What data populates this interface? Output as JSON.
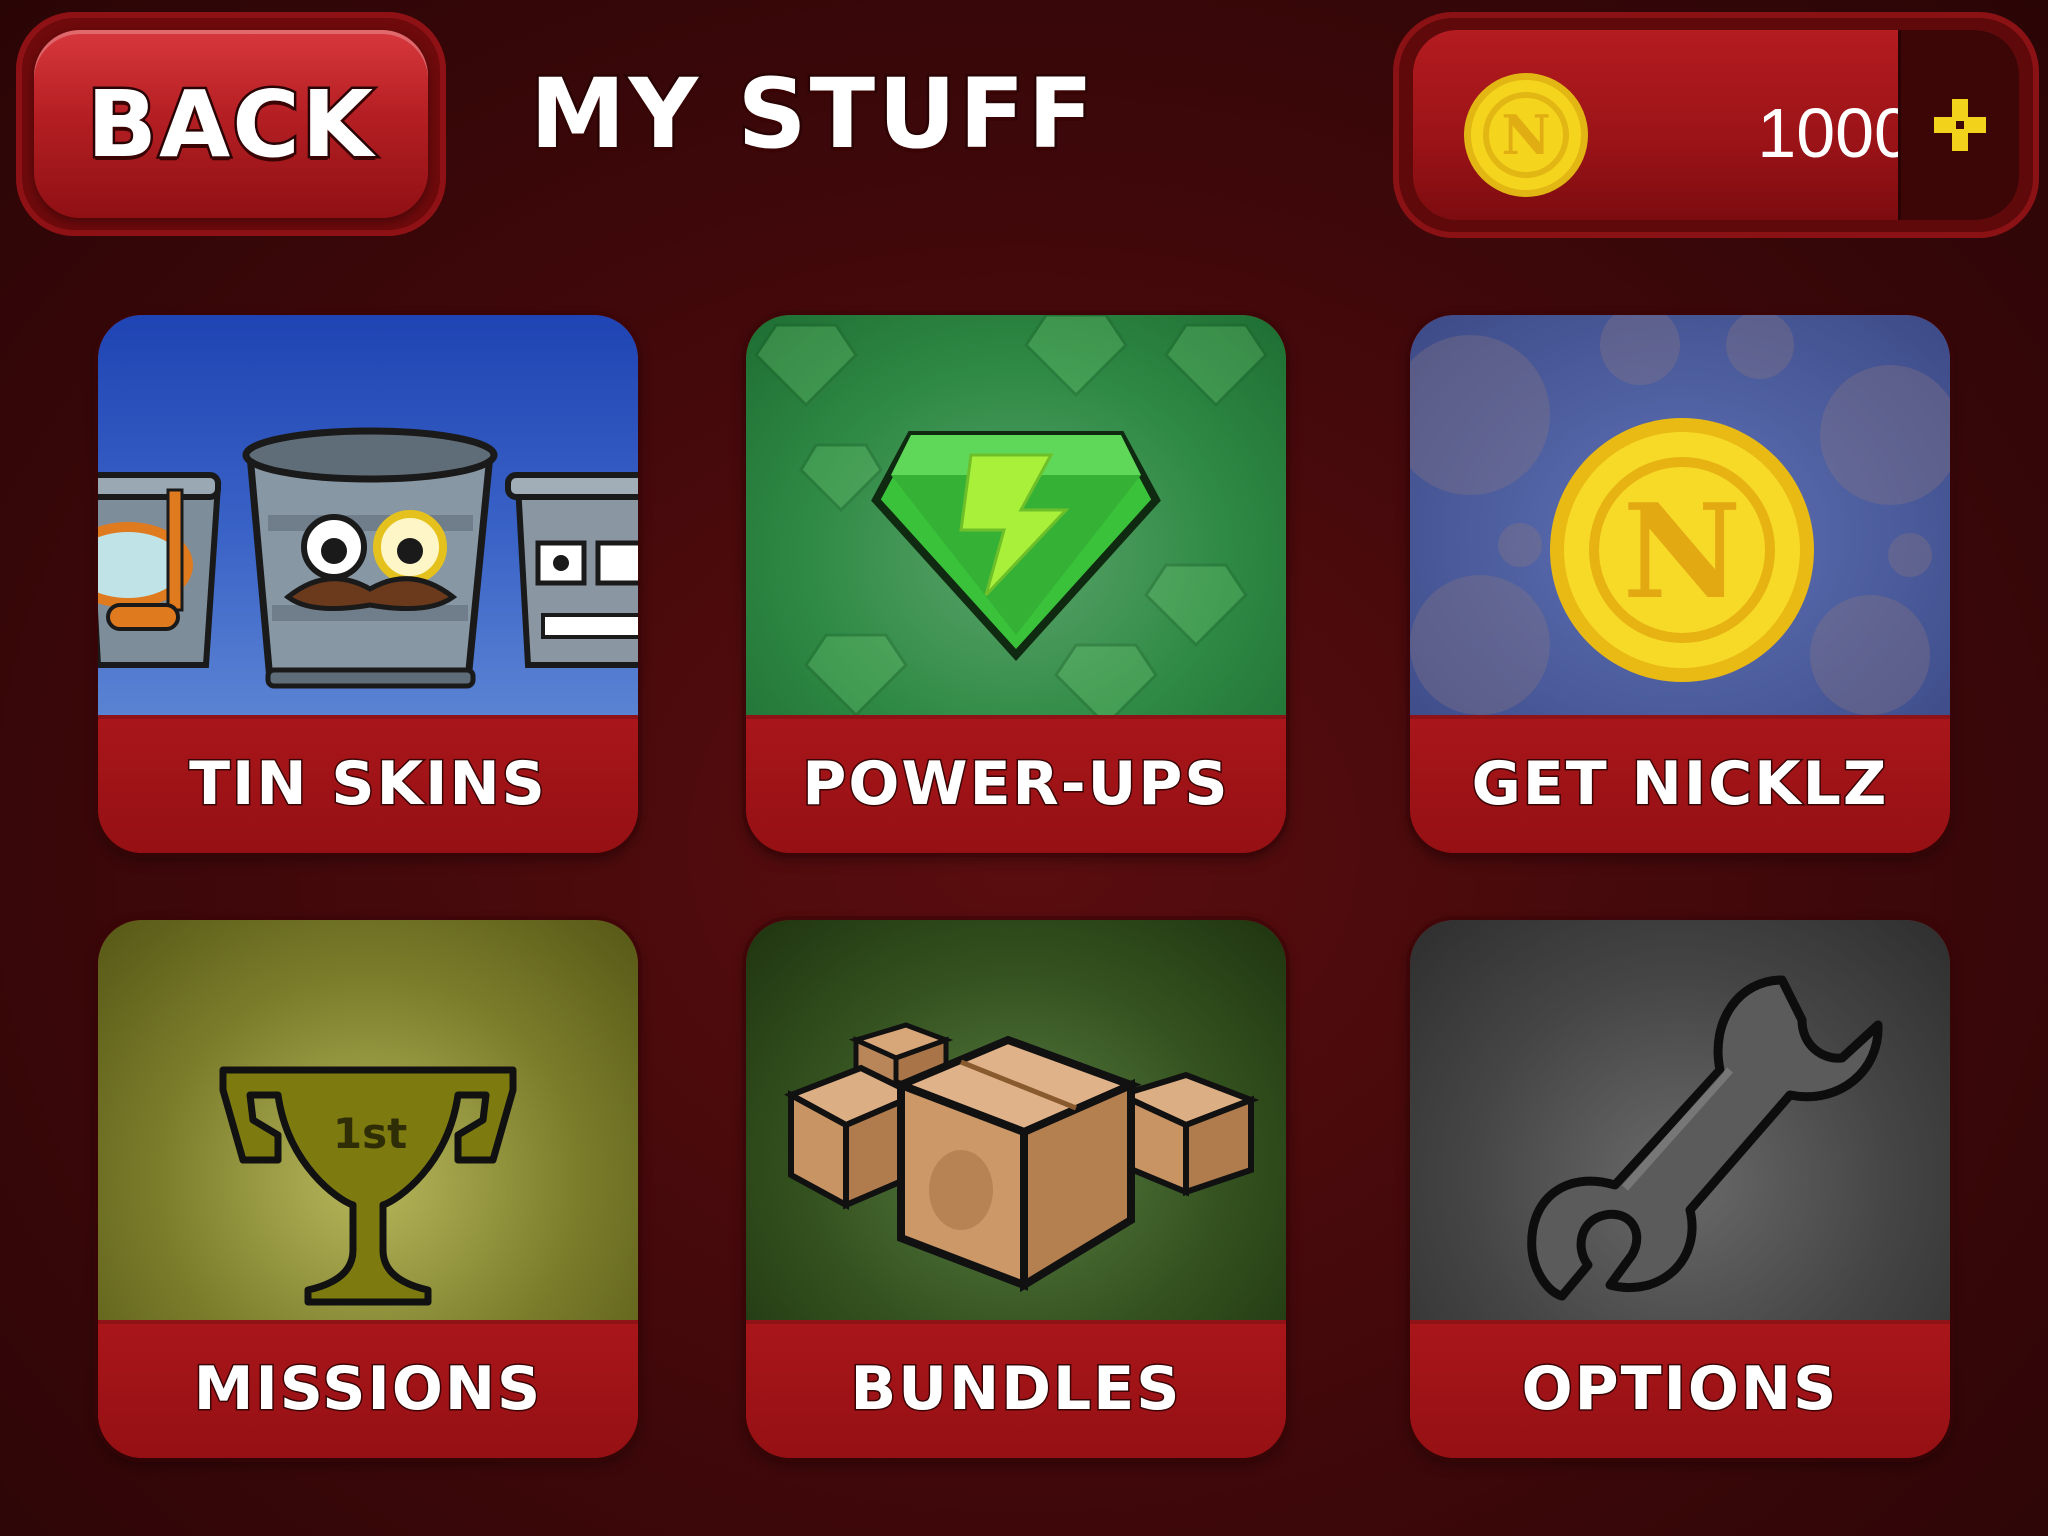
{
  "header": {
    "back_label": "BACK",
    "title": "MY STUFF"
  },
  "currency": {
    "icon": "nicklz-coin-icon",
    "amount": "1000",
    "add_icon": "plus-icon",
    "coin_letter": "N",
    "add_color": "#f2d21a"
  },
  "tiles": [
    {
      "label": "TIN SKINS",
      "icon": "tin-can-characters"
    },
    {
      "label": "POWER-UPS",
      "icon": "lightning-gem-icon"
    },
    {
      "label": "GET NICKLZ",
      "icon": "nicklz-coin-icon"
    },
    {
      "label": "MISSIONS",
      "icon": "trophy-icon",
      "trophy_text": "1st"
    },
    {
      "label": "BUNDLES",
      "icon": "boxes-icon"
    },
    {
      "label": "OPTIONS",
      "icon": "wrench-icon"
    }
  ],
  "colors": {
    "background": "#3f080a",
    "banner_red": "#a01317",
    "coin_gold": "#f5d41e"
  }
}
